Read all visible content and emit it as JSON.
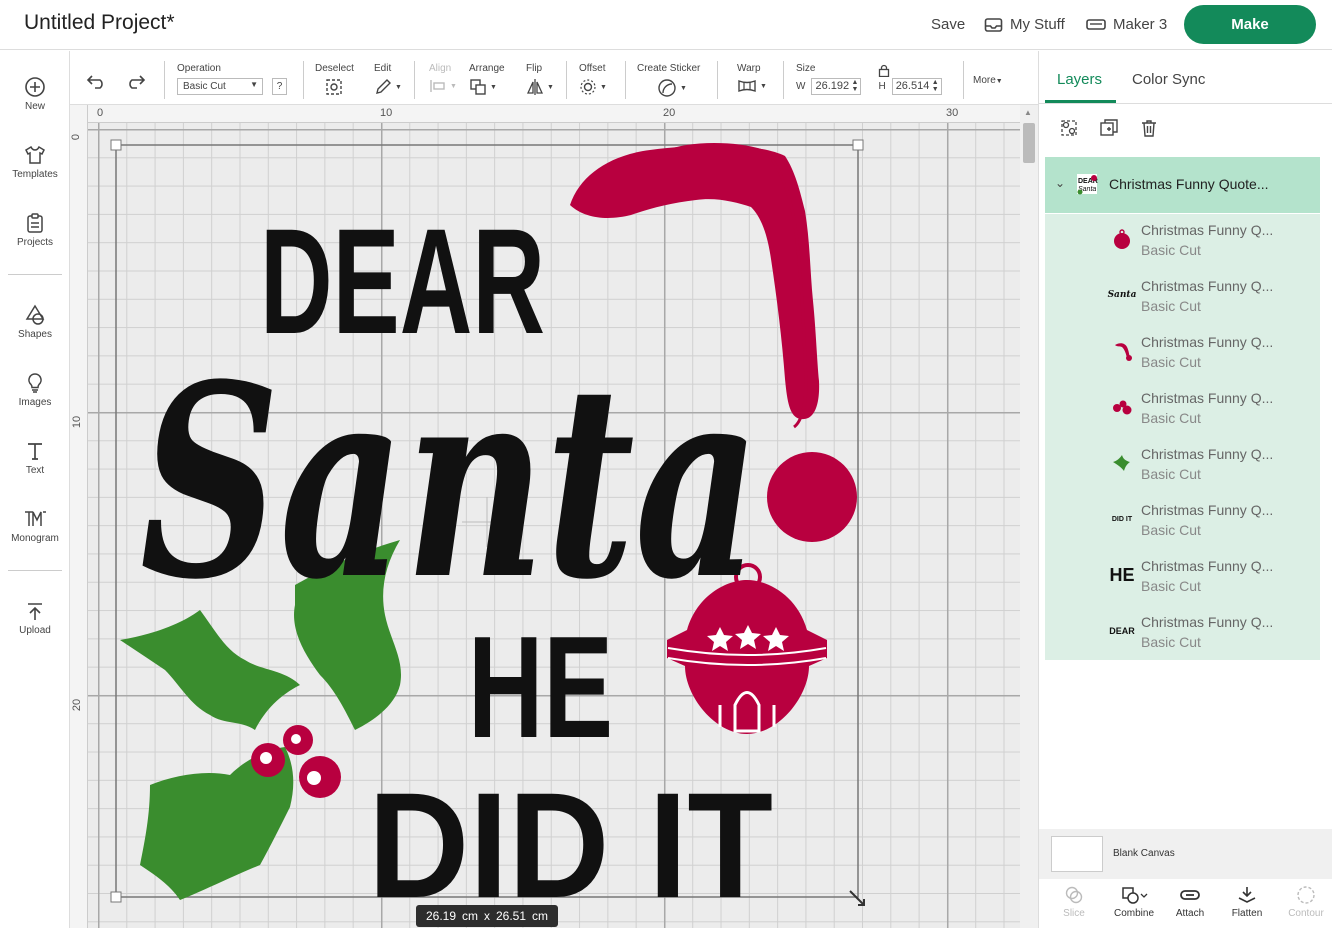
{
  "header": {
    "title": "Untitled Project*",
    "save": "Save",
    "my_stuff": "My Stuff",
    "machine": "Maker 3",
    "make": "Make"
  },
  "leftbar": {
    "items": [
      {
        "label": "New"
      },
      {
        "label": "Templates"
      },
      {
        "label": "Projects"
      },
      {
        "label": "Shapes"
      },
      {
        "label": "Images"
      },
      {
        "label": "Text"
      },
      {
        "label": "Monogram"
      },
      {
        "label": "Upload"
      }
    ]
  },
  "toolbar": {
    "operation_label": "Operation",
    "operation_value": "Basic Cut",
    "help": "?",
    "deselect": "Deselect",
    "edit": "Edit",
    "align": "Align",
    "arrange": "Arrange",
    "flip": "Flip",
    "offset": "Offset",
    "create_sticker": "Create Sticker",
    "warp": "Warp",
    "size": "Size",
    "w_label": "W",
    "w_value": "26.192",
    "h_label": "H",
    "h_value": "26.514",
    "more": "More"
  },
  "rulers": {
    "top": [
      "0",
      "10",
      "20",
      "30"
    ],
    "left": [
      "0",
      "10",
      "20"
    ]
  },
  "design": {
    "line1": "DEAR",
    "line2": "Santa",
    "line3": "HE",
    "line4": "DID IT",
    "red": "#b8003f",
    "green": "#3a8d2e",
    "black": "#111111"
  },
  "size_badge": {
    "w": "26.19",
    "unit1": "cm",
    "x": "x",
    "h": "26.51",
    "unit2": "cm"
  },
  "panel": {
    "tabs": {
      "layers": "Layers",
      "color_sync": "Color Sync"
    },
    "group_name": "Christmas Funny Quote...",
    "layers": [
      {
        "name": "Christmas Funny Q...",
        "op": "Basic Cut",
        "thumb": "bell-icon"
      },
      {
        "name": "Christmas Funny Q...",
        "op": "Basic Cut",
        "thumb": "santa-text-icon",
        "thumb_text": "Santa"
      },
      {
        "name": "Christmas Funny Q...",
        "op": "Basic Cut",
        "thumb": "hat-icon"
      },
      {
        "name": "Christmas Funny Q...",
        "op": "Basic Cut",
        "thumb": "berries-icon"
      },
      {
        "name": "Christmas Funny Q...",
        "op": "Basic Cut",
        "thumb": "holly-icon"
      },
      {
        "name": "Christmas Funny Q...",
        "op": "Basic Cut",
        "thumb": "did-it-text-icon",
        "thumb_text": "DID IT"
      },
      {
        "name": "Christmas Funny Q...",
        "op": "Basic Cut",
        "thumb": "he-text-icon",
        "thumb_text": "HE"
      },
      {
        "name": "Christmas Funny Q...",
        "op": "Basic Cut",
        "thumb": "dear-text-icon",
        "thumb_text": "DEAR"
      }
    ],
    "blank_canvas": "Blank Canvas",
    "bottom": {
      "slice": "Slice",
      "combine": "Combine",
      "attach": "Attach",
      "flatten": "Flatten",
      "contour": "Contour"
    }
  }
}
